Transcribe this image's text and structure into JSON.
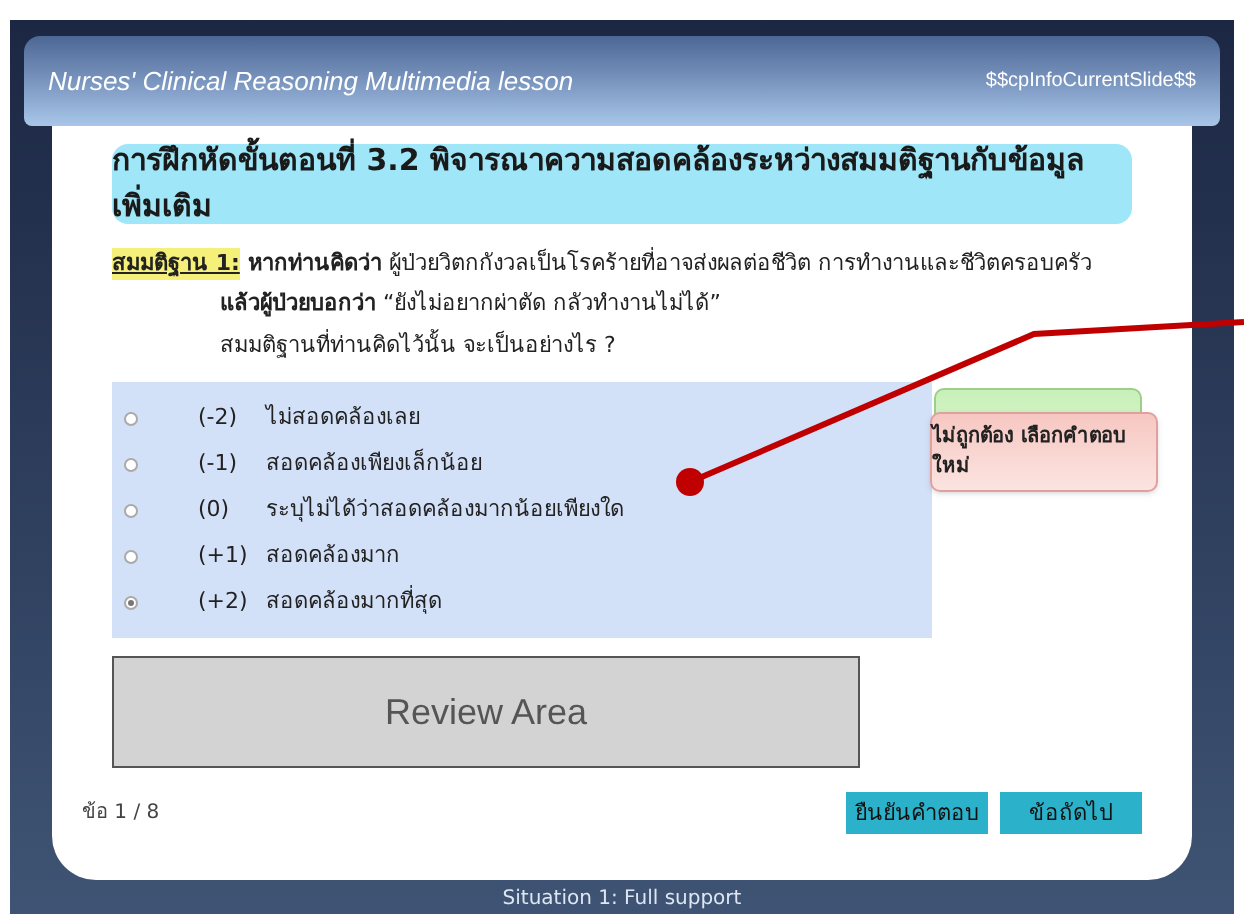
{
  "header": {
    "title": "Nurses' Clinical Reasoning Multimedia lesson",
    "slide_info": "$$cpInfoCurrentSlide$$"
  },
  "exercise_title": "การฝึกหัดขั้นตอนที่ 3.2 พิจารณาความสอดคล้องระหว่างสมมติฐานกับข้อมูลเพิ่มเติม",
  "hypothesis": {
    "label": "สมมติฐาน 1:",
    "lines": [
      "**หากท่านคิดว่า** ผู้ป่วยวิตกกังวลเป็นโรคร้ายที่อาจส่งผลต่อชีวิต การทำงานและชีวิตครอบครัว",
      "**แล้วผู้ป่วยบอกว่า** “ยังไม่อยากผ่าตัด กลัวทำงานไม่ได้”",
      "สมมติฐานที่ท่านคิดไว้นั้น จะเป็นอย่างไร ?"
    ]
  },
  "options": [
    {
      "score": "(-2)",
      "text": "ไม่สอดคล้องเลย",
      "selected": false
    },
    {
      "score": "(-1)",
      "text": "สอดคล้องเพียงเล็กน้อย",
      "selected": false
    },
    {
      "score": "(0)",
      "text": "ระบุไม่ได้ว่าสอดคล้องมากน้อยเพียงใด",
      "selected": false
    },
    {
      "score": "(+1)",
      "text": "สอดคล้องมาก",
      "selected": false
    },
    {
      "score": "(+2)",
      "text": "สอดคล้องมากที่สุด",
      "selected": true
    }
  ],
  "feedback": {
    "message": "ไม่ถูกต้อง เลือกคำตอบใหม่"
  },
  "review_area": "Review Area",
  "progress": "ข้อ 1 / 8",
  "buttons": [
    "ยืนยันคำตอบ",
    "ข้อถัดไป"
  ],
  "footer": "Situation 1: Full support"
}
